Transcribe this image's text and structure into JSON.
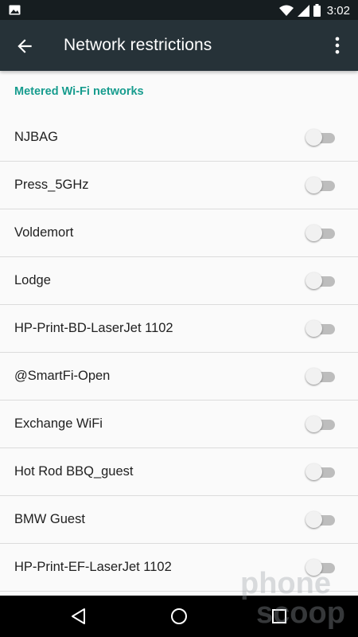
{
  "status_bar": {
    "time": "3:02",
    "icons": [
      "image-icon",
      "wifi-icon",
      "signal-icon",
      "battery-icon"
    ]
  },
  "app_bar": {
    "title": "Network restrictions",
    "back_icon": "arrow-back-icon",
    "menu_icon": "more-vert-icon"
  },
  "section_header": "Metered Wi-Fi networks",
  "accent_color": "#179c8e",
  "networks": [
    {
      "name": "NJBAG",
      "metered": false
    },
    {
      "name": "Press_5GHz",
      "metered": false
    },
    {
      "name": "Voldemort",
      "metered": false
    },
    {
      "name": "Lodge",
      "metered": false
    },
    {
      "name": "HP-Print-BD-LaserJet 1102",
      "metered": false
    },
    {
      "name": "@SmartFi-Open",
      "metered": false
    },
    {
      "name": "Exchange WiFi",
      "metered": false
    },
    {
      "name": "Hot Rod BBQ_guest",
      "metered": false
    },
    {
      "name": "BMW Guest",
      "metered": false
    },
    {
      "name": "HP-Print-EF-LaserJet 1102",
      "metered": false
    }
  ],
  "nav_bar": {
    "buttons": [
      "back-triangle-icon",
      "home-circle-icon",
      "recents-square-icon"
    ]
  }
}
